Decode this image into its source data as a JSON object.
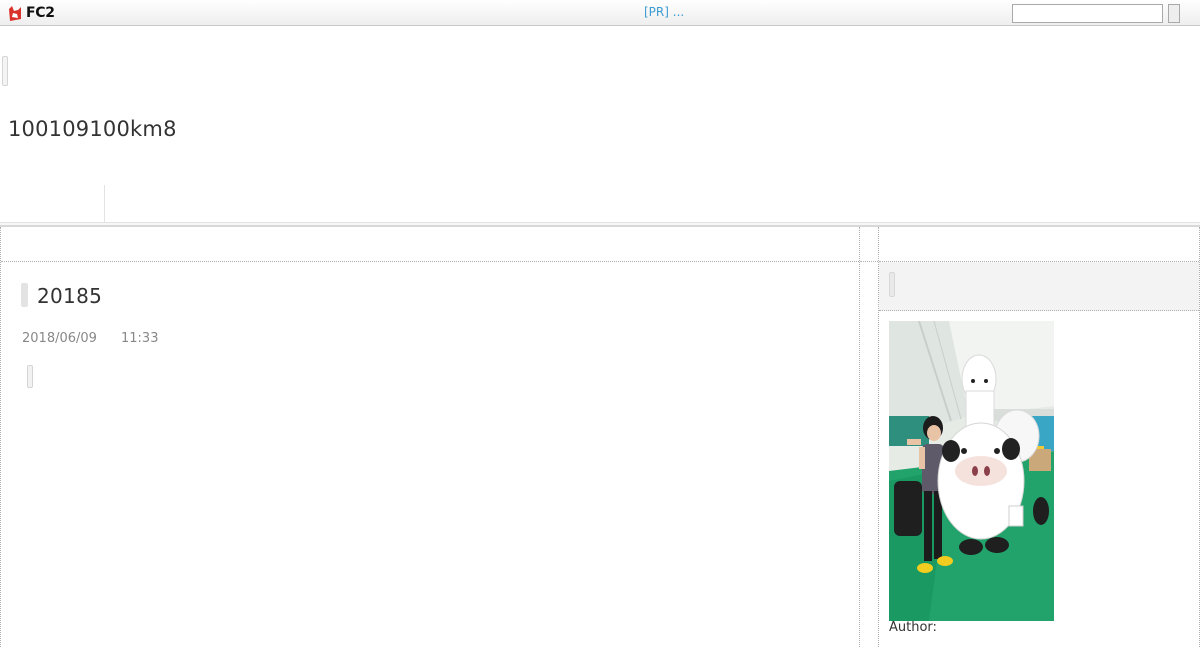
{
  "topbar": {
    "logo_text": "FC2",
    "pr_link": "[PR] ...",
    "search_placeholder": ""
  },
  "header": {
    "blog_title": "100109100km8"
  },
  "entry": {
    "title": "20185",
    "date": "2018/06/09",
    "time": "11:33"
  },
  "sidebar": {
    "author_label": "Author:"
  },
  "colors": {
    "pr_link": "#3d9cd2",
    "logo_red": "#d9322b",
    "floor_green": "#21a36b"
  },
  "icons": {
    "logo": "fc2-fox-icon"
  }
}
